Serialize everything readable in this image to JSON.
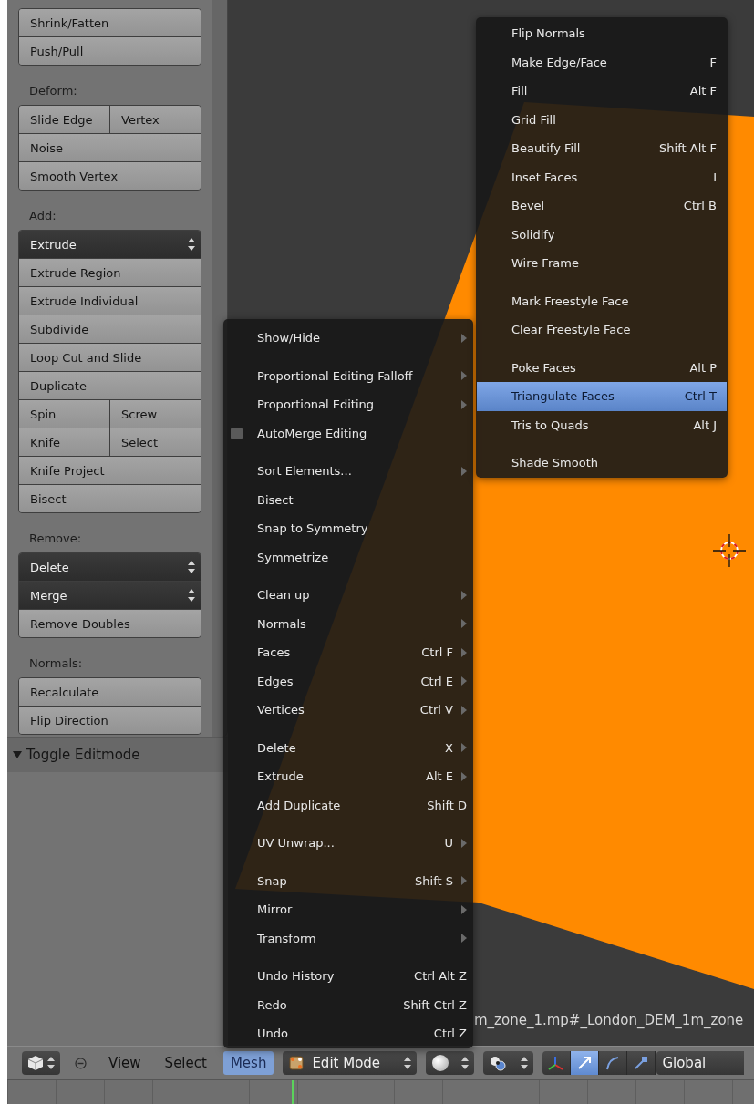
{
  "tool_shelf": {
    "groups": [
      {
        "rows": [
          [
            {
              "label": "Shrink/Fatten",
              "kind": "button"
            }
          ],
          [
            {
              "label": "Push/Pull",
              "kind": "button"
            }
          ]
        ]
      },
      {
        "label": "Deform:",
        "rows": [
          [
            {
              "label": "Slide Edge",
              "kind": "button"
            },
            {
              "label": "Vertex",
              "kind": "button"
            }
          ],
          [
            {
              "label": "Noise",
              "kind": "button"
            }
          ],
          [
            {
              "label": "Smooth Vertex",
              "kind": "button"
            }
          ]
        ]
      },
      {
        "label": "Add:",
        "rows": [
          [
            {
              "label": "Extrude",
              "kind": "dropdown"
            }
          ],
          [
            {
              "label": "Extrude Region",
              "kind": "button"
            }
          ],
          [
            {
              "label": "Extrude Individual",
              "kind": "button"
            }
          ],
          [
            {
              "label": "Subdivide",
              "kind": "button"
            }
          ],
          [
            {
              "label": "Loop Cut and Slide",
              "kind": "button"
            }
          ],
          [
            {
              "label": "Duplicate",
              "kind": "button"
            }
          ],
          [
            {
              "label": "Spin",
              "kind": "button"
            },
            {
              "label": "Screw",
              "kind": "button"
            }
          ],
          [
            {
              "label": "Knife",
              "kind": "button"
            },
            {
              "label": "Select",
              "kind": "button"
            }
          ],
          [
            {
              "label": "Knife Project",
              "kind": "button"
            }
          ],
          [
            {
              "label": "Bisect",
              "kind": "button"
            }
          ]
        ]
      },
      {
        "label": "Remove:",
        "rows": [
          [
            {
              "label": "Delete",
              "kind": "dropdown"
            }
          ],
          [
            {
              "label": "Merge",
              "kind": "dropdown"
            }
          ],
          [
            {
              "label": "Remove Doubles",
              "kind": "button"
            }
          ]
        ]
      },
      {
        "label": "Normals:",
        "rows": [
          [
            {
              "label": "Recalculate",
              "kind": "button"
            }
          ],
          [
            {
              "label": "Flip Direction",
              "kind": "button"
            }
          ]
        ]
      }
    ]
  },
  "panel": {
    "title": "Toggle Editmode",
    "expanded": true
  },
  "viewport": {
    "object_label": "m_zone_1.mp#_London_DEM_1m_zone"
  },
  "mesh_menu": {
    "sections": [
      [
        {
          "label": "Show/Hide",
          "submenu": true,
          "selected": false
        }
      ],
      [
        {
          "label": "Proportional Editing Falloff",
          "submenu": true,
          "selected": false
        },
        {
          "label": "Proportional Editing",
          "submenu": true,
          "selected": false
        },
        {
          "label": "AutoMerge Editing",
          "kind": "checkbox",
          "checked": false,
          "selected": false
        }
      ],
      [
        {
          "label": "Sort Elements...",
          "submenu": true,
          "selected": false
        },
        {
          "label": "Bisect",
          "selected": false
        },
        {
          "label": "Snap to Symmetry",
          "selected": false
        },
        {
          "label": "Symmetrize",
          "selected": false
        }
      ],
      [
        {
          "label": "Clean up",
          "submenu": true,
          "selected": false
        },
        {
          "label": "Normals",
          "submenu": true,
          "selected": false
        },
        {
          "label": "Faces",
          "shortcut": "Ctrl F",
          "submenu": true,
          "selected": false
        },
        {
          "label": "Edges",
          "shortcut": "Ctrl E",
          "submenu": true,
          "selected": false
        },
        {
          "label": "Vertices",
          "shortcut": "Ctrl V",
          "submenu": true,
          "selected": false
        }
      ],
      [
        {
          "label": "Delete",
          "shortcut": "X",
          "submenu": true,
          "selected": false
        },
        {
          "label": "Extrude",
          "shortcut": "Alt E",
          "submenu": true,
          "selected": false
        },
        {
          "label": "Add Duplicate",
          "shortcut": "Shift D",
          "selected": false
        }
      ],
      [
        {
          "label": "UV Unwrap...",
          "shortcut": "U",
          "submenu": true,
          "selected": false
        }
      ],
      [
        {
          "label": "Snap",
          "shortcut": "Shift S",
          "submenu": true,
          "selected": false
        },
        {
          "label": "Mirror",
          "submenu": true,
          "selected": false
        },
        {
          "label": "Transform",
          "submenu": true,
          "selected": false
        }
      ],
      [
        {
          "label": "Undo History",
          "shortcut": "Ctrl Alt Z",
          "selected": false
        },
        {
          "label": "Redo",
          "shortcut": "Shift Ctrl Z",
          "selected": false
        },
        {
          "label": "Undo",
          "shortcut": "Ctrl Z",
          "selected": false
        }
      ]
    ]
  },
  "faces_submenu": {
    "sections": [
      [
        {
          "label": "Flip Normals",
          "selected": false
        },
        {
          "label": "Make Edge/Face",
          "shortcut": "F",
          "selected": false
        },
        {
          "label": "Fill",
          "shortcut": "Alt F",
          "selected": false
        },
        {
          "label": "Grid Fill",
          "selected": false
        },
        {
          "label": "Beautify Fill",
          "shortcut": "Shift Alt F",
          "selected": false
        },
        {
          "label": "Inset Faces",
          "shortcut": "I",
          "selected": false
        },
        {
          "label": "Bevel",
          "shortcut": "Ctrl B",
          "selected": false
        },
        {
          "label": "Solidify",
          "selected": false
        },
        {
          "label": "Wire Frame",
          "selected": false
        }
      ],
      [
        {
          "label": "Mark Freestyle Face",
          "selected": false
        },
        {
          "label": "Clear Freestyle Face",
          "selected": false
        }
      ],
      [
        {
          "label": "Poke Faces",
          "shortcut": "Alt P",
          "selected": false
        },
        {
          "label": "Triangulate Faces",
          "shortcut": "Ctrl T",
          "selected": true
        },
        {
          "label": "Tris to Quads",
          "shortcut": "Alt J",
          "selected": false
        }
      ],
      [
        {
          "label": "Shade Smooth",
          "selected": false
        }
      ]
    ]
  },
  "header": {
    "items": [
      {
        "kind": "editor_type"
      },
      {
        "kind": "collapse"
      },
      {
        "kind": "menu",
        "label": "View",
        "selected": false
      },
      {
        "kind": "menu",
        "label": "Select",
        "selected": false
      },
      {
        "kind": "menu",
        "label": "Mesh",
        "selected": true
      },
      {
        "kind": "mode",
        "label": "Edit Mode"
      },
      {
        "kind": "shading"
      },
      {
        "kind": "pivot"
      },
      {
        "kind": "manipulators",
        "buttons": [
          {
            "kind": "toggle",
            "on": false
          },
          {
            "kind": "translate",
            "on": true
          },
          {
            "kind": "rotate",
            "on": false
          },
          {
            "kind": "scale",
            "on": false
          }
        ]
      },
      {
        "kind": "orientation",
        "label": "Global"
      }
    ]
  }
}
